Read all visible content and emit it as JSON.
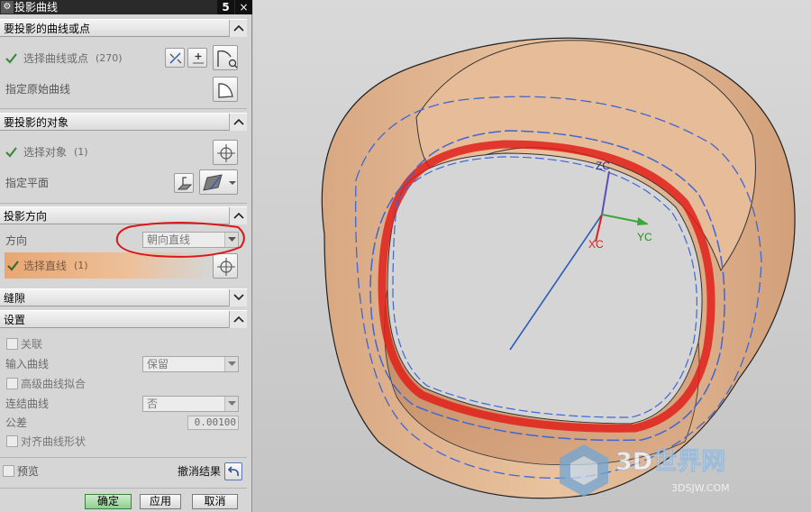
{
  "dialog": {
    "title": "投影曲线",
    "title_icon": "gear-icon",
    "reset_glyph": "5",
    "close_glyph": "×"
  },
  "sections": {
    "curves": {
      "title": "要投影的曲线或点",
      "select_label": "选择曲线或点",
      "select_count": "(270)",
      "original_label": "指定原始曲线"
    },
    "objects": {
      "title": "要投影的对象",
      "select_label": "选择对象",
      "select_count": "(1)",
      "plane_label": "指定平面"
    },
    "direction": {
      "title": "投影方向",
      "direction_label": "方向",
      "direction_value": "朝向直线",
      "line_label": "选择直线",
      "line_count": "(1)"
    },
    "gaps": {
      "title": "缝隙"
    },
    "settings": {
      "title": "设置",
      "associative_label": "关联",
      "input_curves_label": "输入曲线",
      "input_curves_value": "保留",
      "advanced_fit_label": "高级曲线拟合",
      "join_curves_label": "连结曲线",
      "join_curves_value": "否",
      "tolerance_label": "公差",
      "tolerance_value": "0.00100",
      "align_shape_label": "对齐曲线形状"
    }
  },
  "footer": {
    "preview_label": "预览",
    "undo_label": "撤消结果",
    "ok_label": "确定",
    "apply_label": "应用",
    "cancel_label": "取消"
  },
  "viewport": {
    "axis_labels": {
      "zc": "ZC",
      "xc": "XC",
      "yc": "YC"
    },
    "watermark_brand": "3D世界网",
    "watermark_url": "3DSJW.COM"
  },
  "colors": {
    "dialog_bg": "#d6d6d6",
    "selected_row": "#e6a870",
    "check_green": "#3a8a3a",
    "cylinder": "#e2b48e",
    "curves_blue": "#3d66d6",
    "curves_red": "#e0201a",
    "annotation_red": "#d81818"
  }
}
